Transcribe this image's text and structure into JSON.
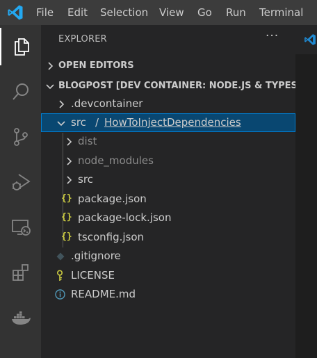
{
  "menubar": {
    "items": [
      "File",
      "Edit",
      "Selection",
      "View",
      "Go",
      "Run",
      "Terminal"
    ]
  },
  "activity_bar": {
    "items": [
      "explorer-icon",
      "search-icon",
      "source-control-icon",
      "run-debug-icon",
      "remote-explorer-icon",
      "extensions-icon",
      "docker-icon"
    ]
  },
  "explorer": {
    "title": "EXPLORER",
    "more": "···",
    "open_editors": "OPEN EDITORS",
    "workspace": "BLOGPOST [DEV CONTAINER: NODE.JS & TYPESCR...",
    "tree": {
      "devcontainer": ".devcontainer",
      "src_label": "src",
      "src_sep": "/",
      "src_sub": "HowToInjectDependencies",
      "dist": "dist",
      "node_modules": "node_modules",
      "src_child": "src",
      "package_json": "package.json",
      "package_lock": "package-lock.json",
      "tsconfig": "tsconfig.json",
      "gitignore": ".gitignore",
      "license": "LICENSE",
      "readme": "README.md",
      "json_glyph": "{}"
    }
  },
  "colors": {
    "accent": "#007acc",
    "selection": "#094771",
    "json_icon": "#cbcb41",
    "license_icon": "#cbcb41",
    "info_icon": "#519aba"
  }
}
